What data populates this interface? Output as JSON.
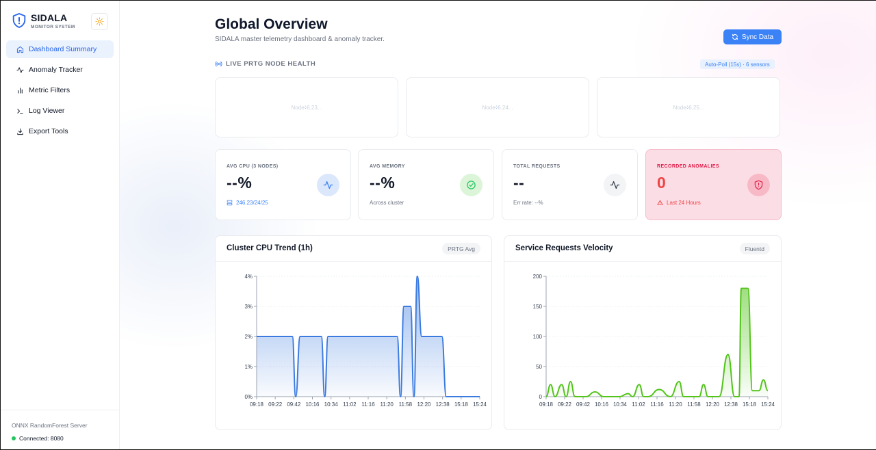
{
  "sidebar": {
    "brand_title": "SIDALA",
    "brand_subtitle": "MONITOR SYSTEM",
    "items": [
      {
        "label": "Dashboard Summary",
        "icon": "home-icon",
        "active": true
      },
      {
        "label": "Anomaly Tracker",
        "icon": "activity-icon",
        "active": false
      },
      {
        "label": "Metric Filters",
        "icon": "bar-chart-icon",
        "active": false
      },
      {
        "label": "Log Viewer",
        "icon": "terminal-icon",
        "active": false
      },
      {
        "label": "Export Tools",
        "icon": "download-icon",
        "active": false
      }
    ],
    "server_name": "ONNX RandomForest Server",
    "connection_status": "Connected: 8080"
  },
  "header": {
    "title": "Global Overview",
    "subtitle": "SIDALA master telemetry dashboard & anomaly tracker.",
    "sync_label": "Sync Data"
  },
  "health": {
    "section_label": "LIVE PRTG NODE HEALTH",
    "poll_badge": "Auto-Poll (15s) · 6 sensors",
    "nodes": [
      {
        "prefix": "Node ",
        "suffix": "6.23..."
      },
      {
        "prefix": "Node ",
        "suffix": "6.24..."
      },
      {
        "prefix": "Node ",
        "suffix": "6.25..."
      }
    ]
  },
  "stats": [
    {
      "label": "AVG CPU (3 NODES)",
      "value": "--%",
      "foot": "246.23/24/25"
    },
    {
      "label": "AVG MEMORY",
      "value": "--%",
      "foot": "Across cluster"
    },
    {
      "label": "TOTAL REQUESTS",
      "value": "--",
      "foot": "Err rate: --%"
    },
    {
      "label": "RECORDED ANOMALIES",
      "value": "0",
      "foot": "Last 24 Hours"
    }
  ],
  "colors": {
    "accent": "#3b82f6",
    "success": "#22c55e",
    "danger": "#ef4444",
    "cpu_line": "#3b7be0",
    "req_line": "#52c41a"
  },
  "charts": {
    "cpu": {
      "title": "Cluster CPU Trend (1h)",
      "badge": "PRTG Avg"
    },
    "requests": {
      "title": "Service Requests Velocity",
      "badge": "Fluentd"
    }
  },
  "chart_data": [
    {
      "type": "area",
      "title": "Cluster CPU Trend (1h)",
      "ylim": [
        0,
        4
      ],
      "y_ticks": [
        "0%",
        "1%",
        "2%",
        "3%",
        "4%"
      ],
      "x_tick_labels": [
        "09:18",
        "09:22",
        "09:42",
        "10:16",
        "10:34",
        "11:02",
        "11:16",
        "11:20",
        "11:58",
        "12:20",
        "12:38",
        "15:18",
        "15:24"
      ],
      "points": [
        [
          0,
          2
        ],
        [
          0.16,
          2
        ],
        [
          0.175,
          0
        ],
        [
          0.195,
          2
        ],
        [
          0.29,
          2
        ],
        [
          0.305,
          0
        ],
        [
          0.32,
          2
        ],
        [
          0.63,
          2
        ],
        [
          0.645,
          0
        ],
        [
          0.66,
          3
        ],
        [
          0.69,
          3
        ],
        [
          0.705,
          0
        ],
        [
          0.72,
          4
        ],
        [
          0.74,
          2
        ],
        [
          0.83,
          2
        ],
        [
          0.85,
          0
        ],
        [
          1.0,
          0
        ]
      ],
      "grid": true,
      "legend": "none"
    },
    {
      "type": "area",
      "title": "Service Requests Velocity",
      "ylim": [
        0,
        200
      ],
      "y_ticks": [
        "0",
        "50",
        "100",
        "150",
        "200"
      ],
      "x_tick_labels": [
        "09:18",
        "09:22",
        "09:42",
        "10:16",
        "10:34",
        "11:02",
        "11:16",
        "11:20",
        "11:58",
        "12:20",
        "12:38",
        "15:18",
        "15:24"
      ],
      "points": [
        [
          0,
          0
        ],
        [
          0.02,
          20
        ],
        [
          0.04,
          0
        ],
        [
          0.07,
          20
        ],
        [
          0.09,
          0
        ],
        [
          0.11,
          25
        ],
        [
          0.13,
          0
        ],
        [
          0.18,
          0
        ],
        [
          0.22,
          8
        ],
        [
          0.26,
          0
        ],
        [
          0.33,
          0
        ],
        [
          0.37,
          5
        ],
        [
          0.39,
          0
        ],
        [
          0.42,
          20
        ],
        [
          0.44,
          0
        ],
        [
          0.46,
          0
        ],
        [
          0.51,
          12
        ],
        [
          0.56,
          0
        ],
        [
          0.6,
          25
        ],
        [
          0.62,
          0
        ],
        [
          0.69,
          0
        ],
        [
          0.71,
          20
        ],
        [
          0.73,
          0
        ],
        [
          0.78,
          0
        ],
        [
          0.82,
          70
        ],
        [
          0.85,
          0
        ],
        [
          0.87,
          0
        ],
        [
          0.88,
          180
        ],
        [
          0.91,
          180
        ],
        [
          0.93,
          10
        ],
        [
          0.96,
          10
        ],
        [
          0.98,
          28
        ],
        [
          1.0,
          10
        ]
      ],
      "grid": true,
      "legend": "none"
    }
  ]
}
